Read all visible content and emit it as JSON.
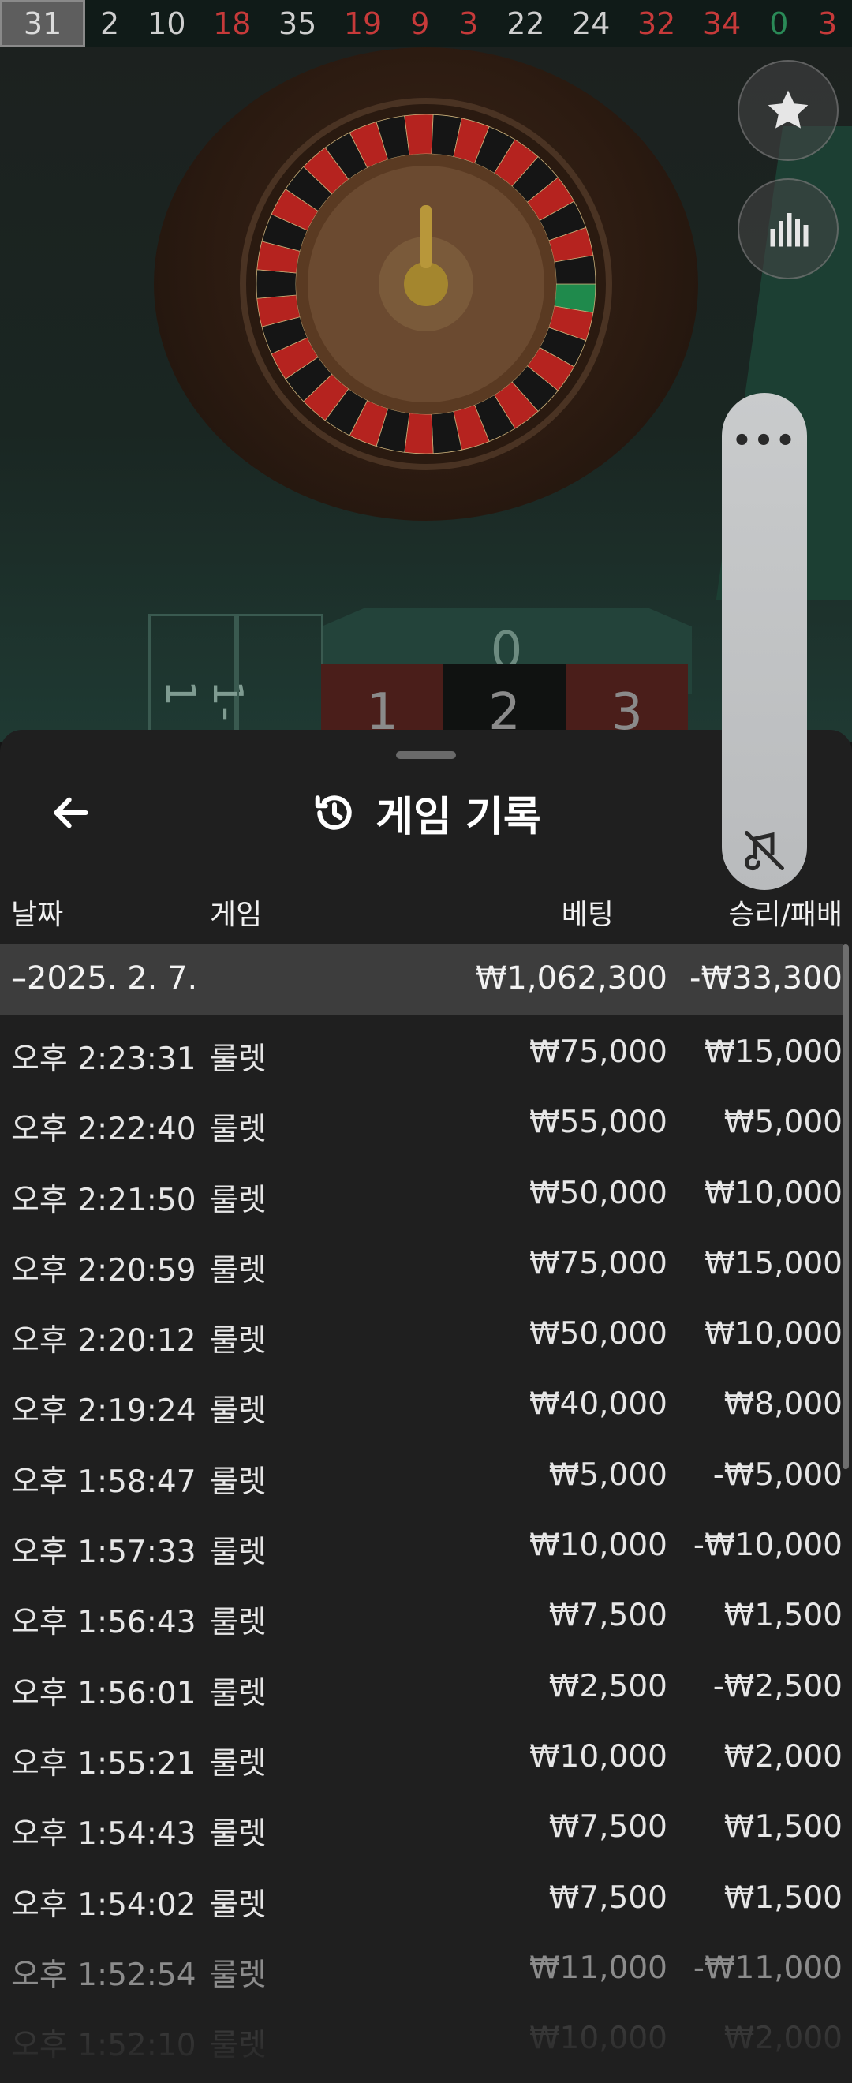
{
  "results_strip": [
    {
      "value": "31",
      "color": "black"
    },
    {
      "value": "2",
      "color": "black"
    },
    {
      "value": "10",
      "color": "black"
    },
    {
      "value": "18",
      "color": "red"
    },
    {
      "value": "35",
      "color": "black"
    },
    {
      "value": "19",
      "color": "red"
    },
    {
      "value": "9",
      "color": "red"
    },
    {
      "value": "3",
      "color": "red"
    },
    {
      "value": "22",
      "color": "black"
    },
    {
      "value": "24",
      "color": "black"
    },
    {
      "value": "32",
      "color": "red"
    },
    {
      "value": "34",
      "color": "red"
    },
    {
      "value": "0",
      "color": "green"
    },
    {
      "value": "3",
      "color": "red"
    }
  ],
  "scene": {
    "zero_label": "0",
    "cells": [
      {
        "label": "1",
        "color": "red"
      },
      {
        "label": "2",
        "color": "black"
      },
      {
        "label": "3",
        "color": "red"
      }
    ],
    "side_label": "1-1"
  },
  "controls": {
    "favorite_icon": "star-icon",
    "stats_icon": "bar-chart-icon",
    "more_label": "•••",
    "mute_icon": "sound-off-icon"
  },
  "history": {
    "title": "게임 기록",
    "title_icon": "history-icon",
    "back_icon": "back-arrow-icon",
    "columns": {
      "date": "날짜",
      "game": "게임",
      "bet": "베팅",
      "result": "승리/패배"
    },
    "date_group": {
      "label": "–2025. 2. 7.",
      "bet": "₩1,062,300",
      "result": "-₩33,300"
    },
    "rows": [
      {
        "time": "오후 2:23:31",
        "game": "룰렛",
        "bet": "₩75,000",
        "result": "₩15,000"
      },
      {
        "time": "오후 2:22:40",
        "game": "룰렛",
        "bet": "₩55,000",
        "result": "₩5,000"
      },
      {
        "time": "오후 2:21:50",
        "game": "룰렛",
        "bet": "₩50,000",
        "result": "₩10,000"
      },
      {
        "time": "오후 2:20:59",
        "game": "룰렛",
        "bet": "₩75,000",
        "result": "₩15,000"
      },
      {
        "time": "오후 2:20:12",
        "game": "룰렛",
        "bet": "₩50,000",
        "result": "₩10,000"
      },
      {
        "time": "오후 2:19:24",
        "game": "룰렛",
        "bet": "₩40,000",
        "result": "₩8,000"
      },
      {
        "time": "오후 1:58:47",
        "game": "룰렛",
        "bet": "₩5,000",
        "result": "-₩5,000"
      },
      {
        "time": "오후 1:57:33",
        "game": "룰렛",
        "bet": "₩10,000",
        "result": "-₩10,000"
      },
      {
        "time": "오후 1:56:43",
        "game": "룰렛",
        "bet": "₩7,500",
        "result": "₩1,500"
      },
      {
        "time": "오후 1:56:01",
        "game": "룰렛",
        "bet": "₩2,500",
        "result": "-₩2,500"
      },
      {
        "time": "오후 1:55:21",
        "game": "룰렛",
        "bet": "₩10,000",
        "result": "₩2,000"
      },
      {
        "time": "오후 1:54:43",
        "game": "룰렛",
        "bet": "₩7,500",
        "result": "₩1,500"
      },
      {
        "time": "오후 1:54:02",
        "game": "룰렛",
        "bet": "₩7,500",
        "result": "₩1,500"
      },
      {
        "time": "오후 1:52:54",
        "game": "룰렛",
        "bet": "₩11,000",
        "result": "-₩11,000"
      },
      {
        "time": "오후 1:52:10",
        "game": "룰렛",
        "bet": "₩10,000",
        "result": "₩2,000"
      }
    ]
  },
  "colors": {
    "red_number": "#c73a3a",
    "black_number": "#cfcfcf",
    "green_number": "#2a8a57",
    "sheet_bg": "#1f1f1f",
    "date_row_bg": "#3d3d3d"
  }
}
